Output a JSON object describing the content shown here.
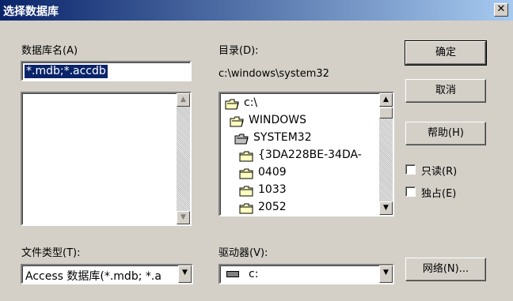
{
  "window": {
    "title": "选择数据库",
    "close_glyph": "✕"
  },
  "db_name": {
    "label": "数据库名(A)",
    "value": "*.mdb;*.accdb"
  },
  "directory": {
    "label": "目录(D):",
    "path": "c:\\windows\\system32",
    "tree": [
      {
        "name": "c:\\",
        "level": 0,
        "state": "open"
      },
      {
        "name": "WINDOWS",
        "level": 1,
        "state": "open"
      },
      {
        "name": "SYSTEM32",
        "level": 2,
        "state": "open-selected"
      },
      {
        "name": "{3DA228BE-34DA-",
        "level": 3,
        "state": "closed"
      },
      {
        "name": "0409",
        "level": 3,
        "state": "closed"
      },
      {
        "name": "1033",
        "level": 3,
        "state": "closed"
      },
      {
        "name": "2052",
        "level": 3,
        "state": "closed"
      }
    ]
  },
  "file_type": {
    "label": "文件类型(T):",
    "value": "Access 数据库(*.mdb; *.a"
  },
  "drives": {
    "label": "驱动器(V):",
    "value": "c:"
  },
  "buttons": {
    "ok": "确定",
    "cancel": "取消",
    "help": "帮助(H)",
    "network": "网络(N)..."
  },
  "options": {
    "readonly": "只读(R)",
    "exclusive": "独占(E)"
  },
  "icons": {
    "up": "▲",
    "down": "▼"
  }
}
